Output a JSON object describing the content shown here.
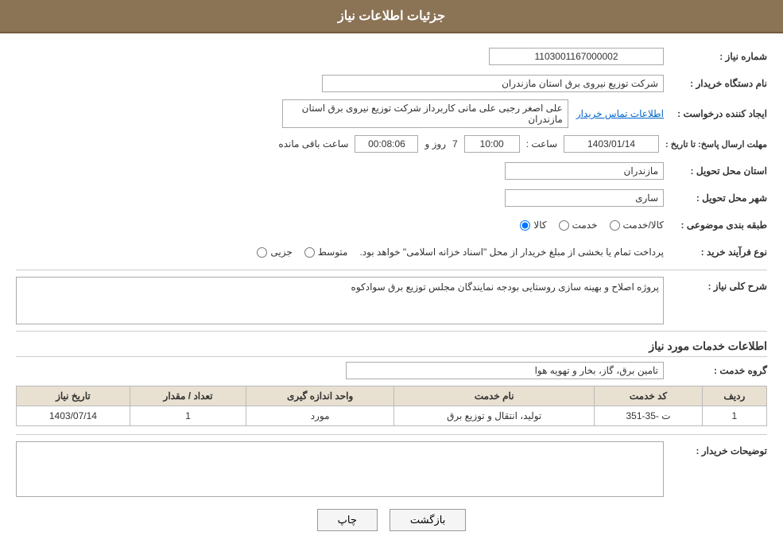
{
  "header": {
    "title": "جزئیات اطلاعات نیاز"
  },
  "fields": {
    "shomareNiaz_label": "شماره نیاز :",
    "shomareNiaz_value": "1103001167000002",
    "namDastgah_label": "نام دستگاه خریدار :",
    "namDastgah_value": "شرکت توزیع نیروی برق استان مازندران",
    "ejadKonande_label": "ایجاد کننده درخواست :",
    "ejadKonande_value": "علی اصغر رجبی علی مانی کاربرداز شرکت توزیع نیروی برق استان مازندران",
    "ejadKonande_link": "اطلاعات تماس خریدار",
    "mohlatErsal_label": "مهلت ارسال پاسخ: تا تاریخ :",
    "tarikh_value": "1403/01/14",
    "saat_label": "ساعت :",
    "saat_value": "10:00",
    "rooz_label": "روز و",
    "rooz_value": "7",
    "baghimande_label": "ساعت باقی مانده",
    "baghimande_value": "00:08:06",
    "ostanTahvil_label": "استان محل تحویل :",
    "ostanTahvil_value": "مازندران",
    "shahrTahvil_label": "شهر محل تحویل :",
    "shahrTahvil_value": "ساری",
    "tabaghe_label": "طبقه بندی موضوعی :",
    "tabaghe_kala": "کالا",
    "tabaghe_khadamat": "خدمت",
    "tabaghe_kala_khadamat": "کالا/خدمت",
    "noe_faravand_label": "نوع فرآیند خرید :",
    "noe_jozei": "جزیی",
    "noe_motavaset": "متوسط",
    "noe_notice": "پرداخت تمام یا بخشی از مبلغ خریدار از محل \"اسناد خزانه اسلامی\" خواهد بود.",
    "sharh_label": "شرح کلی نیاز :",
    "sharh_value": "پروژه اصلاح و بهینه سازی روستایی بودجه نمایندگان مجلس توزیع برق سوادکوه",
    "khadamat_section": "اطلاعات خدمات مورد نیاز",
    "grouh_label": "گروه خدمت :",
    "grouh_value": "تامین برق، گاز، بخار و تهویه هوا",
    "table": {
      "headers": [
        "ردیف",
        "کد خدمت",
        "نام خدمت",
        "واحد اندازه گیری",
        "تعداد / مقدار",
        "تاریخ نیاز"
      ],
      "rows": [
        {
          "radif": "1",
          "kod": "ت -35-351",
          "nam": "تولید، انتقال و توزیع برق",
          "vahed": "مورد",
          "tedad": "1",
          "tarikh": "1403/07/14"
        }
      ]
    },
    "tosihKharidar_label": "توضیحات خریدار :",
    "btn_print": "چاپ",
    "btn_back": "بازگشت"
  }
}
